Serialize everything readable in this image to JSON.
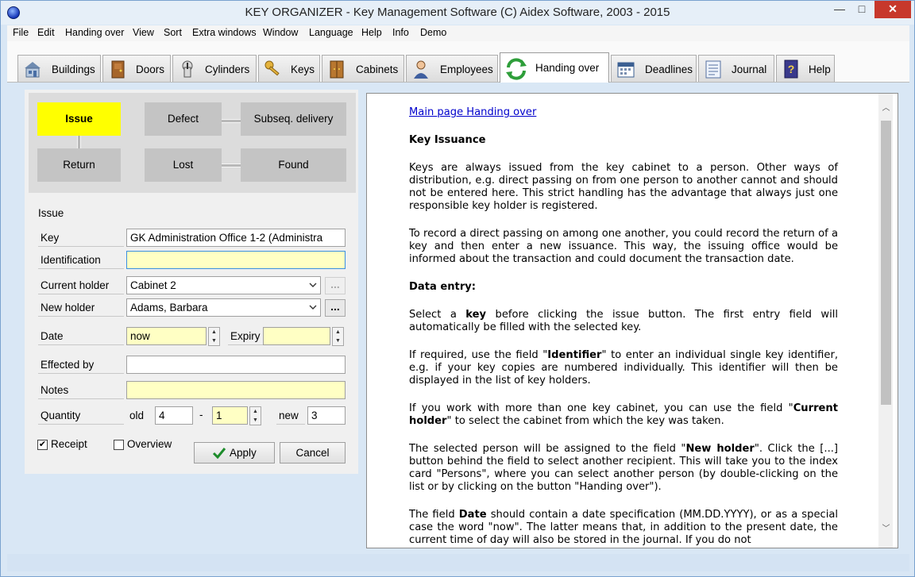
{
  "window": {
    "title": "KEY ORGANIZER  -  Key Management Software    (C) Aidex Software, 2003 - 2015",
    "min_symbol": "—",
    "max_symbol": "□",
    "close_symbol": "✕"
  },
  "menu": [
    "File",
    "Edit",
    "Handing over",
    "View",
    "Sort",
    "Extra windows",
    "Window",
    "Language",
    "Help",
    "Info",
    "Demo"
  ],
  "tabs": [
    {
      "label": "Buildings",
      "icon": "building-icon"
    },
    {
      "label": "Doors",
      "icon": "door-icon"
    },
    {
      "label": "Cylinders",
      "icon": "cylinder-icon"
    },
    {
      "label": "Keys",
      "icon": "key-icon"
    },
    {
      "label": "Cabinets",
      "icon": "cabinet-icon"
    },
    {
      "label": "Employees",
      "icon": "employee-icon"
    },
    {
      "label": "Handing over",
      "icon": "handing-over-icon",
      "active": true
    },
    {
      "label": "Deadlines",
      "icon": "calendar-icon"
    },
    {
      "label": "Journal",
      "icon": "journal-icon"
    },
    {
      "label": "Help",
      "icon": "help-book-icon"
    }
  ],
  "states": {
    "issue": "Issue",
    "defect": "Defect",
    "subseq_delivery": "Subseq. delivery",
    "return": "Return",
    "lost": "Lost",
    "found": "Found",
    "active_color": "#ffff00"
  },
  "form": {
    "section_title": "Issue",
    "key_label": "Key",
    "key_value": "GK Administration Office 1-2  (Administra",
    "identification_label": "Identification",
    "identification_value": "",
    "current_holder_label": "Current holder",
    "current_holder_value": "Cabinet 2",
    "new_holder_label": "New holder",
    "new_holder_value": "Adams, Barbara",
    "dots": "...",
    "date_label": "Date",
    "date_value": "now",
    "expiry_label": "Expiry",
    "expiry_value": "",
    "effected_by_label": "Effected by",
    "effected_by_value": "",
    "notes_label": "Notes",
    "notes_value": "",
    "quantity_label": "Quantity",
    "old_label": "old",
    "old_value": "4",
    "dash": "-",
    "delta_value": "1",
    "new_label": "new",
    "new_value": "3",
    "receipt_label": "Receipt",
    "receipt_checked": true,
    "overview_label": "Overview",
    "overview_checked": false,
    "apply_label": "Apply",
    "cancel_label": "Cancel",
    "field_yellow": "#ffffc4"
  },
  "help": {
    "link": "Main page Handing over",
    "heading": "Key Issuance",
    "p1": "Keys are always issued from the key cabinet to a person. Other ways of distribution, e.g. direct passing on from one person to another cannot and should not be entered here. This strict handling has the advantage that always just one responsible key holder is registered.",
    "p2": "To record a direct passing on among one another, you could record the return of a key and then enter a new issuance. This way, the issuing office would be informed about the transaction and could document the transaction date.",
    "data_entry": "Data entry:",
    "p3a": "Select a ",
    "p3b": "key",
    "p3c": " before clicking the issue button. The first entry field will automatically be filled with the selected key.",
    "p4a": "If required, use the field \"",
    "p4b": "Identifier",
    "p4c": "\" to enter an individual single key identifier, e.g. if your key copies are numbered individually. This identifier will then be displayed in the list of key holders.",
    "p5a": "If you work with more than one key cabinet, you can use the field \"",
    "p5b": "Current holder",
    "p5c": "\" to select the cabinet from which the key was taken.",
    "p6a": "The selected person will be assigned to the field \"",
    "p6b": "New holder",
    "p6c": "\". Click the [...] button behind the field to select another recipient. This will take you to the index card \"Persons\", where you can select another person (by double-clicking on the list or by clicking on the button \"Handing over\").",
    "p7a": "The field ",
    "p7b": "Date",
    "p7c": " should contain a date specification (MM.DD.YYYY), or as a special case the word \"now\". The latter means that, in addition to the present date, the current time of day will also be stored in the journal. If you do not"
  }
}
